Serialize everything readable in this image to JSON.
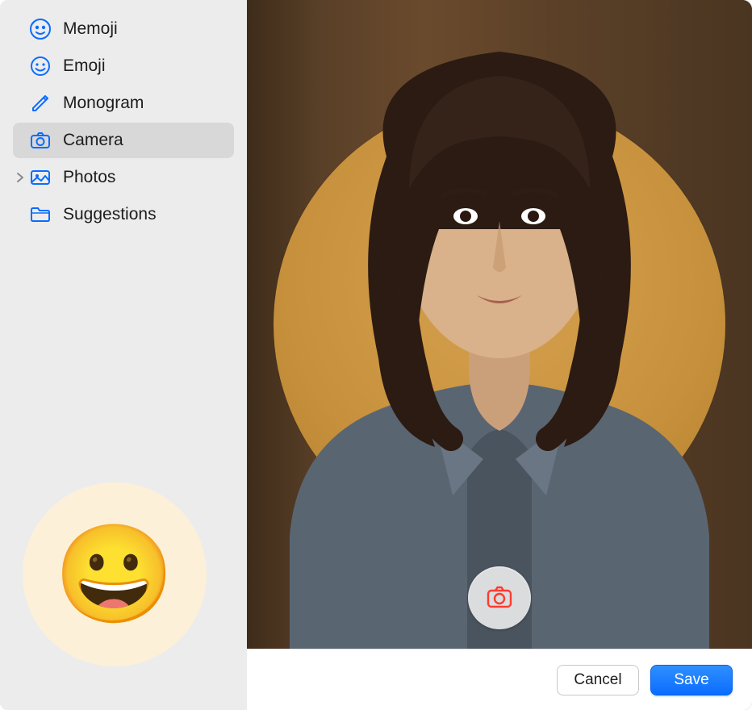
{
  "sidebar": {
    "items": [
      {
        "label": "Memoji",
        "icon": "memoji-face-icon"
      },
      {
        "label": "Emoji",
        "icon": "emoji-smile-icon"
      },
      {
        "label": "Monogram",
        "icon": "pencil-icon"
      },
      {
        "label": "Camera",
        "icon": "camera-icon"
      },
      {
        "label": "Photos",
        "icon": "photos-icon"
      },
      {
        "label": "Suggestions",
        "icon": "folder-icon"
      }
    ],
    "selected_index": 3
  },
  "current_avatar": {
    "type": "emoji",
    "emoji": "😀"
  },
  "footer": {
    "cancel_label": "Cancel",
    "save_label": "Save"
  },
  "colors": {
    "accent": "#0a6cff",
    "sidebar_bg": "#ececec",
    "sidebar_selected": "#d8d8d8"
  }
}
